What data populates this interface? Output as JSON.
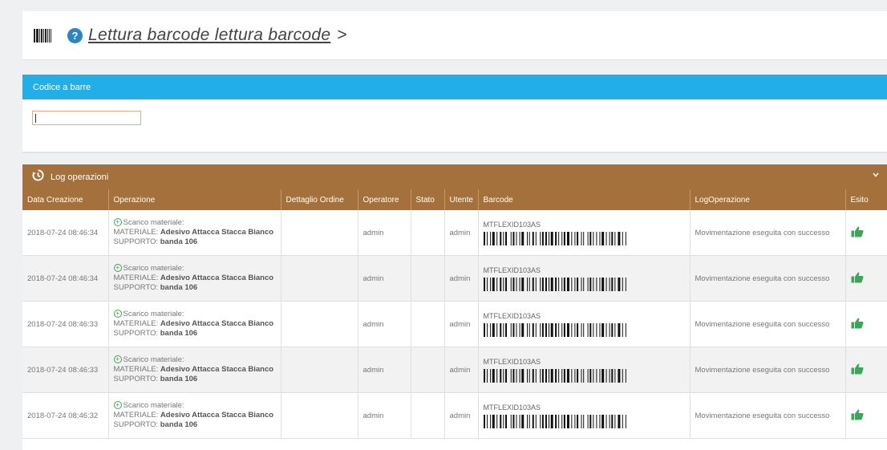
{
  "header": {
    "title": "Lettura barcode lettura barcode",
    "arrow": ">",
    "help_glyph": "?",
    "icon": "barcode-icon"
  },
  "barcode_panel": {
    "title": "Codice a barre",
    "input_value": ""
  },
  "log_panel": {
    "title": "Log operazioni",
    "icon": "history-icon",
    "collapse_glyph": "⌄",
    "columns": [
      "Data Creazione",
      "Operazione",
      "Dettaglio Ordine",
      "Operatore",
      "Stato",
      "Utente",
      "Barcode",
      "LogOperazione",
      "Esito"
    ],
    "rows": [
      {
        "date": "2018-07-24 08:46:34",
        "op_type": "Scarico materiale:",
        "materiale_label": "MATERIALE:",
        "materiale_value": "Adesivo Attacca Stacca Bianco",
        "supporto_label": "SUPPORTO:",
        "supporto_value": "banda 106",
        "dettaglio": "",
        "operatore": "admin",
        "stato": "",
        "utente": "admin",
        "barcode": "MTFLEXID103AS",
        "log": "Movimentazione eseguita con successo",
        "esito": "thumbs-up-icon"
      },
      {
        "date": "2018-07-24 08:46:34",
        "op_type": "Scarico materiale:",
        "materiale_label": "MATERIALE:",
        "materiale_value": "Adesivo Attacca Stacca Bianco",
        "supporto_label": "SUPPORTO:",
        "supporto_value": "banda 106",
        "dettaglio": "",
        "operatore": "admin",
        "stato": "",
        "utente": "admin",
        "barcode": "MTFLEXID103AS",
        "log": "Movimentazione eseguita con successo",
        "esito": "thumbs-up-icon"
      },
      {
        "date": "2018-07-24 08:46:33",
        "op_type": "Scarico materiale:",
        "materiale_label": "MATERIALE:",
        "materiale_value": "Adesivo Attacca Stacca Bianco",
        "supporto_label": "SUPPORTO:",
        "supporto_value": "banda 106",
        "dettaglio": "",
        "operatore": "admin",
        "stato": "",
        "utente": "admin",
        "barcode": "MTFLEXID103AS",
        "log": "Movimentazione eseguita con successo",
        "esito": "thumbs-up-icon"
      },
      {
        "date": "2018-07-24 08:46:33",
        "op_type": "Scarico materiale:",
        "materiale_label": "MATERIALE:",
        "materiale_value": "Adesivo Attacca Stacca Bianco",
        "supporto_label": "SUPPORTO:",
        "supporto_value": "banda 106",
        "dettaglio": "",
        "operatore": "admin",
        "stato": "",
        "utente": "admin",
        "barcode": "MTFLEXID103AS",
        "log": "Movimentazione eseguita con successo",
        "esito": "thumbs-up-icon"
      },
      {
        "date": "2018-07-24 08:46:32",
        "op_type": "Scarico materiale:",
        "materiale_label": "MATERIALE:",
        "materiale_value": "Adesivo Attacca Stacca Bianco",
        "supporto_label": "SUPPORTO:",
        "supporto_value": "banda 106",
        "dettaglio": "",
        "operatore": "admin",
        "stato": "",
        "utente": "admin",
        "barcode": "MTFLEXID103AS",
        "log": "Movimentazione eseguita con successo",
        "esito": "thumbs-up-icon"
      }
    ]
  },
  "colors": {
    "blue_header": "#22aee6",
    "brown_header": "#a4713c",
    "success_green": "#3aa657"
  }
}
